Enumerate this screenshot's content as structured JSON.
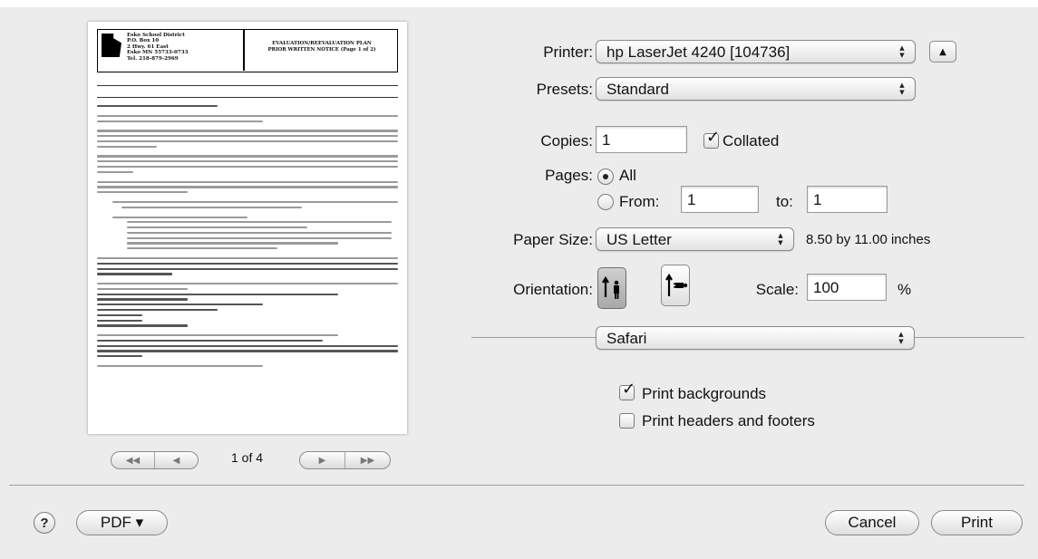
{
  "dialog": {
    "printer_label": "Printer:",
    "printer_value": "hp LaserJet 4240 [104736]",
    "presets_label": "Presets:",
    "presets_value": "Standard",
    "copies_label": "Copies:",
    "copies_value": "1",
    "collated_label": "Collated",
    "collated_checked": true,
    "pages_label": "Pages:",
    "pages_all_label": "All",
    "pages_from_label": "From:",
    "pages_from_value": "1",
    "pages_to_label": "to:",
    "pages_to_value": "1",
    "pages_selected": "All",
    "paper_size_label": "Paper Size:",
    "paper_size_value": "US Letter",
    "paper_size_dims": "8.50 by 11.00 inches",
    "orientation_label": "Orientation:",
    "orientation_selected": "portrait",
    "scale_label": "Scale:",
    "scale_value": "100",
    "scale_unit": "%",
    "section_value": "Safari",
    "print_backgrounds_label": "Print backgrounds",
    "print_backgrounds_checked": true,
    "print_headers_label": "Print headers and footers",
    "print_headers_checked": false
  },
  "preview": {
    "page_indicator": "1 of 4",
    "doc_school": "Esko School District\nP.O. Box 10\n2 Hwy. 61 East\nEsko MN 55733-0733\nTel. 218-879-2969",
    "doc_title": "EVALUATION/REEVALUATION PLAN\nPRIOR WRITTEN NOTICE (Page 1 of 2)"
  },
  "footer": {
    "help_label": "?",
    "pdf_label": "PDF ▾",
    "cancel_label": "Cancel",
    "print_label": "Print"
  },
  "icons": {
    "popup_arrows": "updown-arrows-icon",
    "disclosure": "disclosure-triangle-icon",
    "pager_first": "first-page-icon",
    "pager_prev": "previous-page-icon",
    "pager_next": "next-page-icon",
    "pager_last": "last-page-icon",
    "portrait": "portrait-orientation-icon",
    "landscape": "landscape-orientation-icon"
  }
}
